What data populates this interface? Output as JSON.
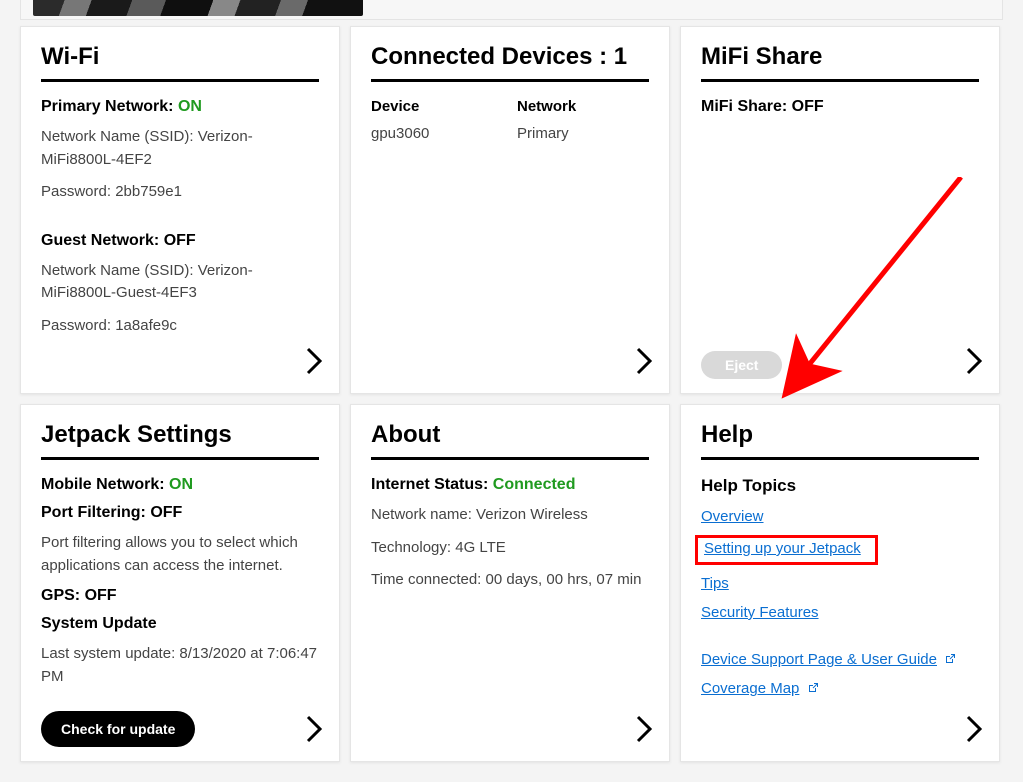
{
  "wifi": {
    "title": "Wi-Fi",
    "primary_label": "Primary Network: ",
    "primary_status": "ON",
    "primary_ssid_label": "Network Name (SSID): ",
    "primary_ssid_value": "Verizon-MiFi8800L-4EF2",
    "primary_pw_label": "Password: ",
    "primary_pw_value": "2bb759e1",
    "guest_label": "Guest Network: OFF",
    "guest_ssid_label": "Network Name (SSID): ",
    "guest_ssid_value": "Verizon-MiFi8800L-Guest-4EF3",
    "guest_pw_label": "Password: ",
    "guest_pw_value": "1a8afe9c"
  },
  "devices": {
    "title": "Connected Devices : 1",
    "col_device": "Device",
    "col_network": "Network",
    "rows": [
      {
        "device": "gpu3060",
        "network": "Primary"
      }
    ]
  },
  "mifishare": {
    "title": "MiFi Share",
    "status_line": "MiFi Share: OFF",
    "eject_label": "Eject"
  },
  "jetpack": {
    "title": "Jetpack Settings",
    "mobile_label": "Mobile Network: ",
    "mobile_status": "ON",
    "portfilter_label": "Port Filtering: OFF",
    "portfilter_desc": "Port filtering allows you to select which applications can access the internet.",
    "gps_label": "GPS: OFF",
    "update_label": "System Update",
    "update_line": "Last system update: 8/13/2020 at 7:06:47 PM",
    "check_btn": "Check for update"
  },
  "about": {
    "title": "About",
    "internet_label": "Internet Status: ",
    "internet_status": "Connected",
    "net_name_label": "Network name: ",
    "net_name_value": "Verizon Wireless",
    "tech_label": "Technology: ",
    "tech_value": "4G LTE",
    "time_label": "Time connected: ",
    "time_value": "00 days, 00 hrs, 07 min"
  },
  "help": {
    "title": "Help",
    "topics_title": "Help Topics",
    "links": {
      "overview": "Overview",
      "setup": "Setting up your Jetpack",
      "tips": "Tips",
      "security": "Security Features",
      "support": "Device Support Page & User Guide",
      "coverage": "Coverage Map"
    }
  }
}
